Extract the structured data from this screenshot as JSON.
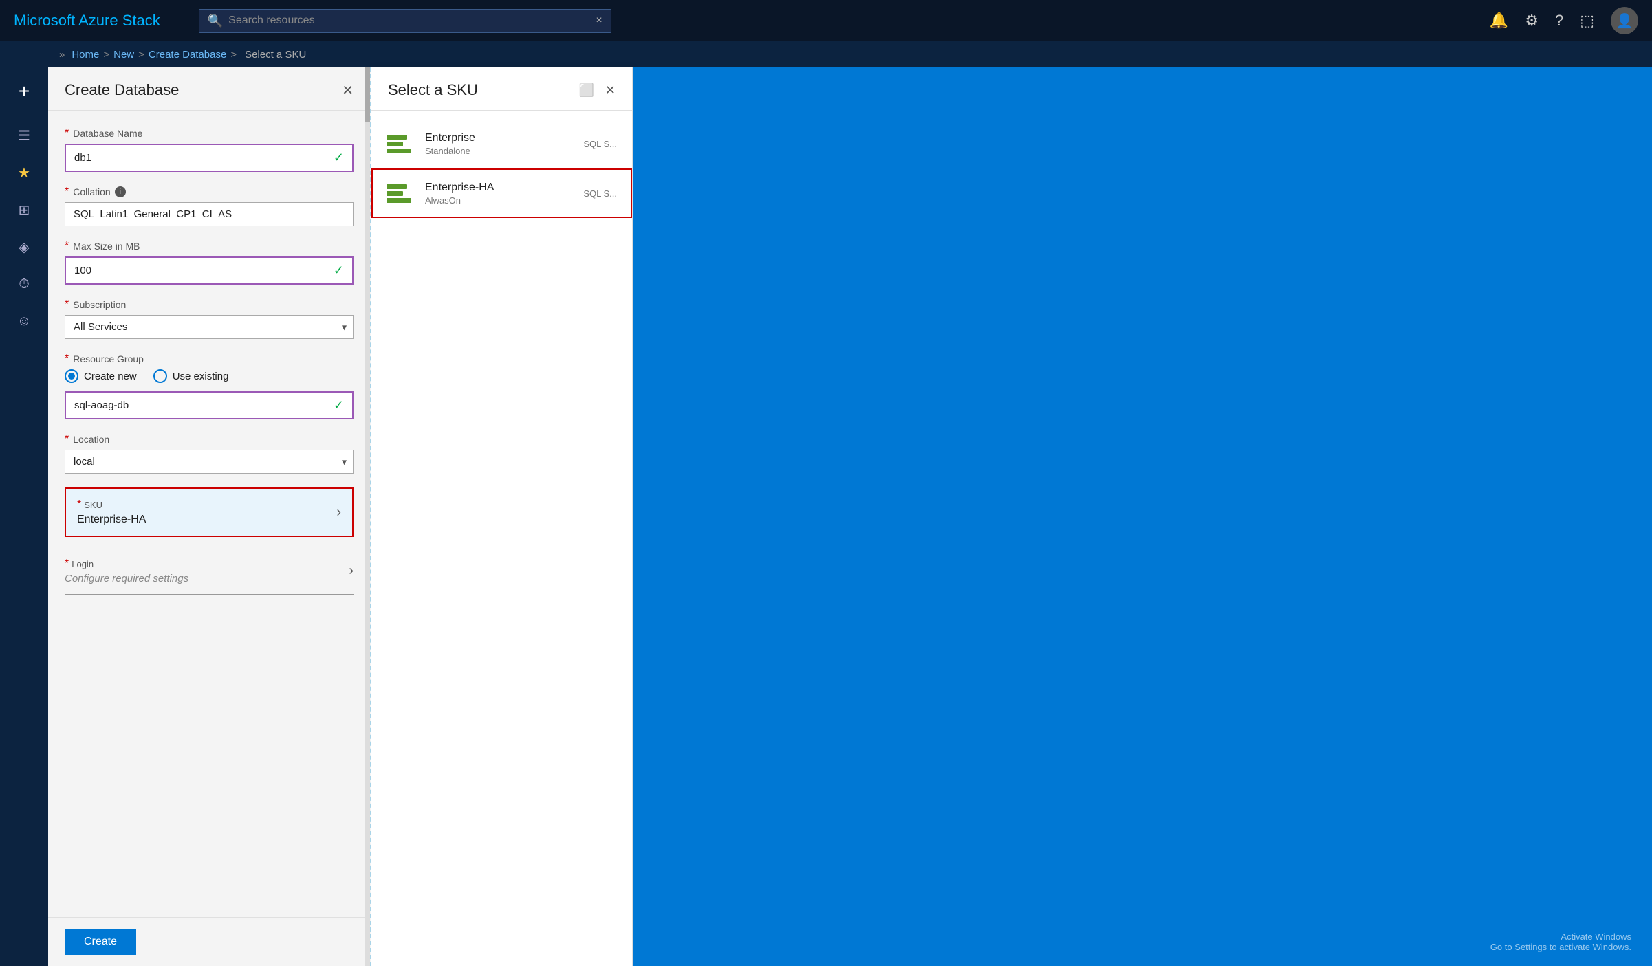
{
  "topbar": {
    "title": "Microsoft Azure Stack",
    "search_placeholder": "Search resources",
    "search_clear": "×"
  },
  "breadcrumb": {
    "home": "Home",
    "sep1": ">",
    "new": "New",
    "sep2": ">",
    "create_database": "Create Database",
    "sep3": ">",
    "current": "Select a SKU"
  },
  "sidebar": {
    "add_label": "+",
    "items": [
      {
        "name": "menu-icon",
        "icon": "☰"
      },
      {
        "name": "star-icon",
        "icon": "★"
      },
      {
        "name": "grid-icon",
        "icon": "⊞"
      },
      {
        "name": "cube-icon",
        "icon": "◈"
      },
      {
        "name": "clock-icon",
        "icon": "🕐"
      },
      {
        "name": "face-icon",
        "icon": "☺"
      }
    ]
  },
  "create_panel": {
    "title": "Create Database",
    "close_label": "✕",
    "fields": {
      "database_name_label": "Database Name",
      "database_name_value": "db1",
      "collation_label": "Collation",
      "collation_info": "ⓘ",
      "collation_value": "SQL_Latin1_General_CP1_CI_AS",
      "max_size_label": "Max Size in MB",
      "max_size_value": "100",
      "subscription_label": "Subscription",
      "subscription_value": "All Services",
      "resource_group_label": "Resource Group",
      "radio_create_new": "Create new",
      "radio_use_existing": "Use existing",
      "resource_group_value": "sql-aoag-db",
      "location_label": "Location",
      "location_value": "local",
      "sku_label": "SKU",
      "sku_value": "Enterprise-HA",
      "login_label": "Login",
      "login_placeholder": "Configure required settings"
    },
    "create_button": "Create"
  },
  "sku_panel": {
    "title": "Select a SKU",
    "minimize_label": "⬜",
    "close_label": "✕",
    "items": [
      {
        "name": "Enterprise",
        "sub": "Standalone",
        "extra": "SQL S...",
        "selected": false
      },
      {
        "name": "Enterprise-HA",
        "sub": "AlwasOn",
        "extra": "SQL S...",
        "selected": true
      }
    ]
  },
  "activate_windows": {
    "line1": "Activate Windows",
    "line2": "Go to Settings to activate Windows."
  }
}
